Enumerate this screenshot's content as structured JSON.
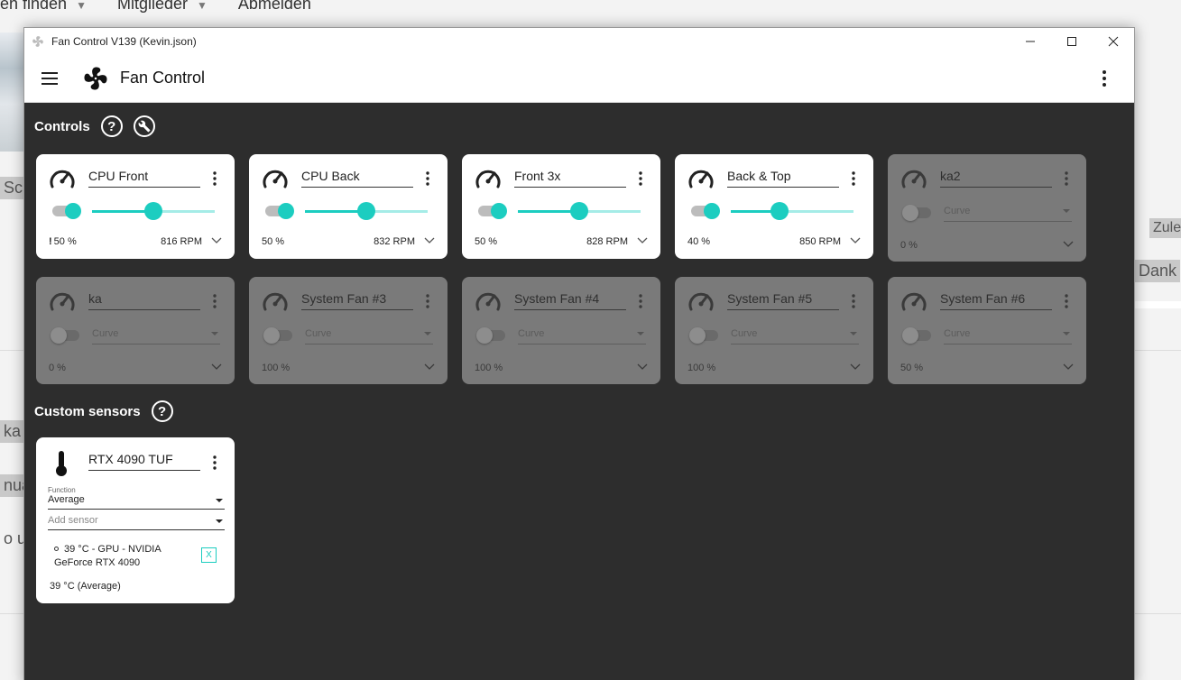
{
  "background": {
    "nav": [
      "en finden",
      "Mitglieder",
      "Abmelden"
    ],
    "labels": [
      "Scre",
      "Zulet",
      "Dank",
      "ka",
      "nua",
      "o un"
    ]
  },
  "window": {
    "title": "Fan Control V139 (Kevin.json)",
    "app_title": "Fan Control"
  },
  "controls": {
    "heading": "Controls",
    "help_glyph": "?",
    "cards": [
      {
        "name": "CPU Front",
        "enabled": true,
        "warn": "!",
        "percent": "50 %",
        "rpm": "816 RPM",
        "level": 0.5
      },
      {
        "name": "CPU Back",
        "enabled": true,
        "warn": "",
        "percent": "50 %",
        "rpm": "832 RPM",
        "level": 0.5
      },
      {
        "name": "Front 3x",
        "enabled": true,
        "warn": "",
        "percent": "50 %",
        "rpm": "828 RPM",
        "level": 0.5
      },
      {
        "name": "Back & Top",
        "enabled": true,
        "warn": "",
        "percent": "40 %",
        "rpm": "850 RPM",
        "level": 0.4
      },
      {
        "name": "ka2",
        "enabled": false,
        "curve": "Curve",
        "percent": "0 %"
      },
      {
        "name": "ka",
        "enabled": false,
        "curve": "Curve",
        "percent": "0 %"
      },
      {
        "name": "System Fan #3",
        "enabled": false,
        "curve": "Curve",
        "percent": "100 %"
      },
      {
        "name": "System Fan #4",
        "enabled": false,
        "curve": "Curve",
        "percent": "100 %"
      },
      {
        "name": "System Fan #5",
        "enabled": false,
        "curve": "Curve",
        "percent": "100 %"
      },
      {
        "name": "System Fan #6",
        "enabled": false,
        "curve": "Curve",
        "percent": "50 %"
      }
    ]
  },
  "custom_sensors": {
    "heading": "Custom sensors",
    "help_glyph": "?",
    "card": {
      "name": "RTX 4090 TUF",
      "function_label": "Function",
      "function_value": "Average",
      "add_sensor_placeholder": "Add sensor",
      "entry_line1": "39 °C - GPU - NVIDIA",
      "entry_line2": "GeForce RTX 4090",
      "remove_label": "X",
      "result": "39 °C (Average)"
    }
  },
  "colors": {
    "accent": "#1ccdc0",
    "accent_light": "#a5ece7",
    "panel_bg": "#2d2d2d",
    "card_disabled": "#7a7a7a"
  }
}
